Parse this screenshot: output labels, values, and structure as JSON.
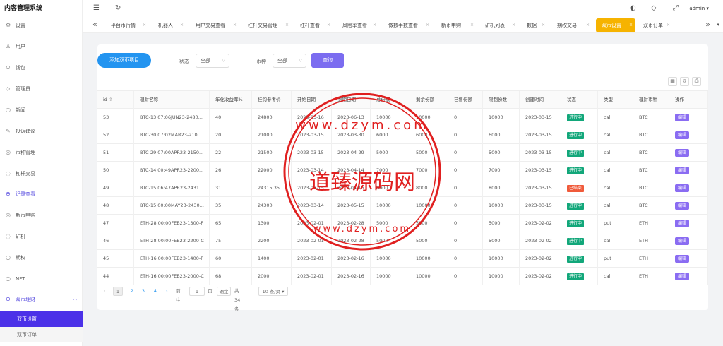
{
  "app_title": "内容管理系统",
  "sidebar": {
    "items": [
      {
        "label": "设置",
        "icon": "gear-icon",
        "glyph": "⚙"
      },
      {
        "label": "用户",
        "icon": "user-icon",
        "glyph": "♙"
      },
      {
        "label": "钱包",
        "icon": "wallet-icon",
        "glyph": "⊙"
      },
      {
        "label": "管理员",
        "icon": "shield-icon",
        "glyph": "◇"
      },
      {
        "label": "新闻",
        "icon": "news-icon",
        "glyph": "○"
      },
      {
        "label": "投诉建议",
        "icon": "feedback-icon",
        "glyph": "✎"
      },
      {
        "label": "币种管理",
        "icon": "coin-icon",
        "glyph": "◎"
      },
      {
        "label": "杠杆交易",
        "icon": "leverage-icon",
        "glyph": "◌"
      },
      {
        "label": "记录查看",
        "icon": "record-icon",
        "glyph": "⊖"
      },
      {
        "label": "新币申购",
        "icon": "new-coin-icon",
        "glyph": "◎"
      },
      {
        "label": "矿机",
        "icon": "miner-icon",
        "glyph": "◌"
      },
      {
        "label": "期权",
        "icon": "option-icon",
        "glyph": "○"
      },
      {
        "label": "NFT",
        "icon": "nft-icon",
        "glyph": "○"
      },
      {
        "label": "双币理财",
        "icon": "finance-icon",
        "glyph": "⊖"
      }
    ],
    "subitems": [
      "双币设置",
      "双币订单"
    ]
  },
  "header": {
    "user": "admin",
    "icons": [
      "collapse-icon",
      "refresh-icon",
      "palette-icon",
      "tag-icon",
      "fullscreen-icon"
    ]
  },
  "tabs": [
    "平台币行情",
    "机器人",
    "用户交易查看",
    "杠杆交易管理",
    "杠杆查看",
    "风险率查看",
    "做数手数查看",
    "新币申购",
    "矿机列表",
    "数据",
    "期权交易",
    "双币设置",
    "双币订单"
  ],
  "toolbar": {
    "add_label": "添加双币项目",
    "status_label": "状态",
    "status_value": "全部",
    "coin_label": "币种",
    "coin_value": "全部",
    "query_label": "查询"
  },
  "table": {
    "columns": [
      "id",
      "理财名称",
      "年化收益率%",
      "挂钩参考价",
      "开始日期",
      "到期日期",
      "总份额",
      "剩余份额",
      "已售份额",
      "限制份数",
      "创建时间",
      "状态",
      "类型",
      "理财币种",
      "操作"
    ],
    "edit_label": "编辑",
    "rows": [
      [
        "53",
        "BTC-13 07:06JUN23-2480...",
        "40",
        "24800",
        "2023-03-16",
        "2023-06-13",
        "10000",
        "10000",
        "0",
        "10000",
        "2023-03-15",
        "进行中",
        "call",
        "BTC"
      ],
      [
        "52",
        "BTC-30 07:02MAR23-210...",
        "20",
        "21000",
        "2023-03-15",
        "2023-03-30",
        "6000",
        "6000",
        "0",
        "6000",
        "2023-03-15",
        "进行中",
        "call",
        "BTC"
      ],
      [
        "51",
        "BTC-29 07:00APR23-2150...",
        "22",
        "21500",
        "2023-03-15",
        "2023-04-29",
        "5000",
        "5000",
        "0",
        "5000",
        "2023-03-15",
        "进行中",
        "call",
        "BTC"
      ],
      [
        "50",
        "BTC-14 00:49APR23-2200...",
        "26",
        "22000",
        "2023-03-14",
        "2023-04-14",
        "7000",
        "7000",
        "0",
        "7000",
        "2023-03-15",
        "进行中",
        "call",
        "BTC"
      ],
      [
        "49",
        "BTC-15 06:47APR23-2431...",
        "31",
        "24315.35",
        "2023-03-15",
        "2023-04-15",
        "8000",
        "8000",
        "0",
        "8000",
        "2023-03-15",
        "已结束",
        "call",
        "BTC"
      ],
      [
        "48",
        "BTC-15 00:00MAY23-2430...",
        "35",
        "24300",
        "2023-03-14",
        "2023-05-15",
        "10000",
        "10000",
        "0",
        "10000",
        "2023-03-15",
        "进行中",
        "call",
        "BTC"
      ],
      [
        "47",
        "ETH-28 00:00FEB23-1300-P",
        "65",
        "1300",
        "2023-02-01",
        "2023-02-28",
        "5000",
        "5000",
        "0",
        "5000",
        "2023-02-02",
        "进行中",
        "put",
        "ETH"
      ],
      [
        "46",
        "ETH-28 00:00FEB23-2200-C",
        "75",
        "2200",
        "2023-02-01",
        "2023-02-28",
        "5000",
        "5000",
        "0",
        "5000",
        "2023-02-02",
        "进行中",
        "call",
        "ETH"
      ],
      [
        "45",
        "ETH-16 00:00FEB23-1400-P",
        "60",
        "1400",
        "2023-02-01",
        "2023-02-16",
        "10000",
        "10000",
        "0",
        "10000",
        "2023-02-02",
        "进行中",
        "put",
        "ETH"
      ],
      [
        "44",
        "ETH-16 00:00FEB23-2000-C",
        "68",
        "2000",
        "2023-02-01",
        "2023-02-16",
        "10000",
        "10000",
        "0",
        "10000",
        "2023-02-02",
        "进行中",
        "call",
        "ETH"
      ]
    ]
  },
  "pagination": {
    "pages": [
      "1",
      "2",
      "3",
      "4"
    ],
    "goto_label": "前往",
    "goto_value": "1",
    "page_unit": "页",
    "confirm_label": "确定",
    "total_label": "共 34 条",
    "page_size": "10 条/页"
  },
  "watermark": {
    "title": "道臻源码网",
    "top_text": "www.dzym.com",
    "bottom_text": "www.dzym.com"
  },
  "colors": {
    "accent": "#4b31e8",
    "active_tab": "#f6b300",
    "add_button": "#2394f0",
    "query_button": "#7b6cf0",
    "status_running": "#12a77a",
    "status_ended": "#f05a3a",
    "edit_button": "#8a6cf2",
    "watermark": "#e02020"
  }
}
